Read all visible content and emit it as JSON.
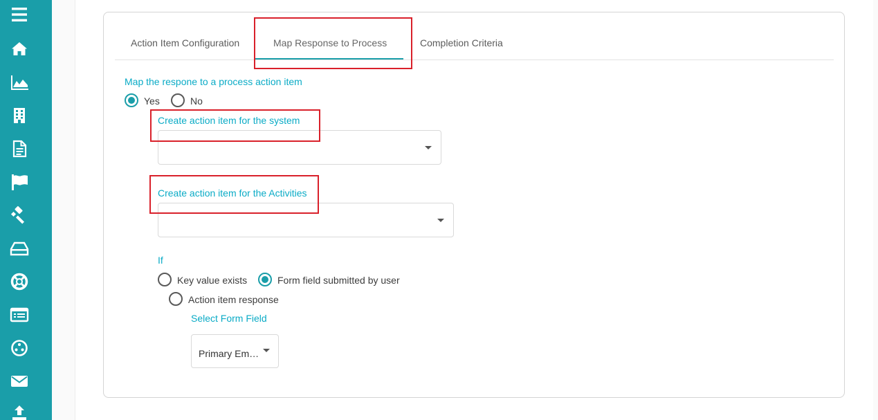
{
  "sidebar": {
    "accent": "#1a9ea9",
    "icons": [
      "menu-icon",
      "home-icon",
      "area-chart-icon",
      "building-icon",
      "document-icon",
      "flag-icon",
      "gavel-icon",
      "inbox-drive-icon",
      "lifebuoy-icon",
      "list-card-icon",
      "network-icon",
      "mail-icon",
      "upload-icon"
    ]
  },
  "tabs": [
    {
      "label": "Action Item Configuration"
    },
    {
      "label": "Map Response to Process"
    },
    {
      "label": "Completion Criteria"
    }
  ],
  "active_tab": "Map Response to Process",
  "map_section": {
    "label": "Map the respone to a process action item",
    "options": [
      {
        "label": "Yes",
        "checked": true
      },
      {
        "label": "No",
        "checked": false
      }
    ]
  },
  "system_field": {
    "label": "Create action item for the system",
    "value": ""
  },
  "activities_field": {
    "label": "Create action item for the Activities",
    "value": ""
  },
  "condition": {
    "label": "If",
    "options": [
      {
        "label": "Key value exists",
        "checked": false
      },
      {
        "label": "Form field submitted by user",
        "checked": true
      },
      {
        "label": "Action item response",
        "checked": false
      }
    ]
  },
  "form_field": {
    "label": "Select Form Field",
    "value": "Primary Em…"
  },
  "colors": {
    "accent": "#1a9ea9",
    "label_teal": "#0aabc6",
    "highlight": "#d9202a"
  }
}
